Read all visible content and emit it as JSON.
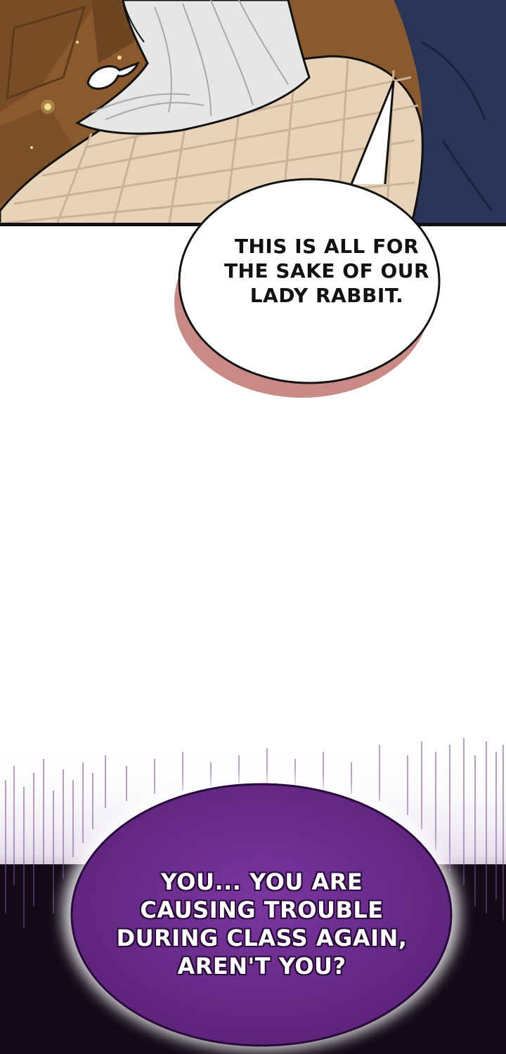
{
  "panel_top": {
    "colors": {
      "wood": "#8a5a2e",
      "wood_dark": "#5c3a1c",
      "hair": "#e6e6e4",
      "coat": "#e8d3b8",
      "plaid": "#c9b396",
      "navy": "#2b3558",
      "sparkle": "#f3e08a"
    }
  },
  "bubble1": {
    "text": "THIS IS ALL FOR\nTHE SAKE OF OUR\nLADY RABBIT.",
    "fill": "#ffffff",
    "shadow": "#c98a86",
    "outline": "#111111"
  },
  "bubble2": {
    "text": "YOU... YOU ARE\nCAUSING TROUBLE\nDURING CLASS AGAIN,\nAREN'T YOU?",
    "fill": "#6a2c8e",
    "glow": "#ffffff",
    "backdrop": "#120b17",
    "streaks": "#7b4a96"
  }
}
